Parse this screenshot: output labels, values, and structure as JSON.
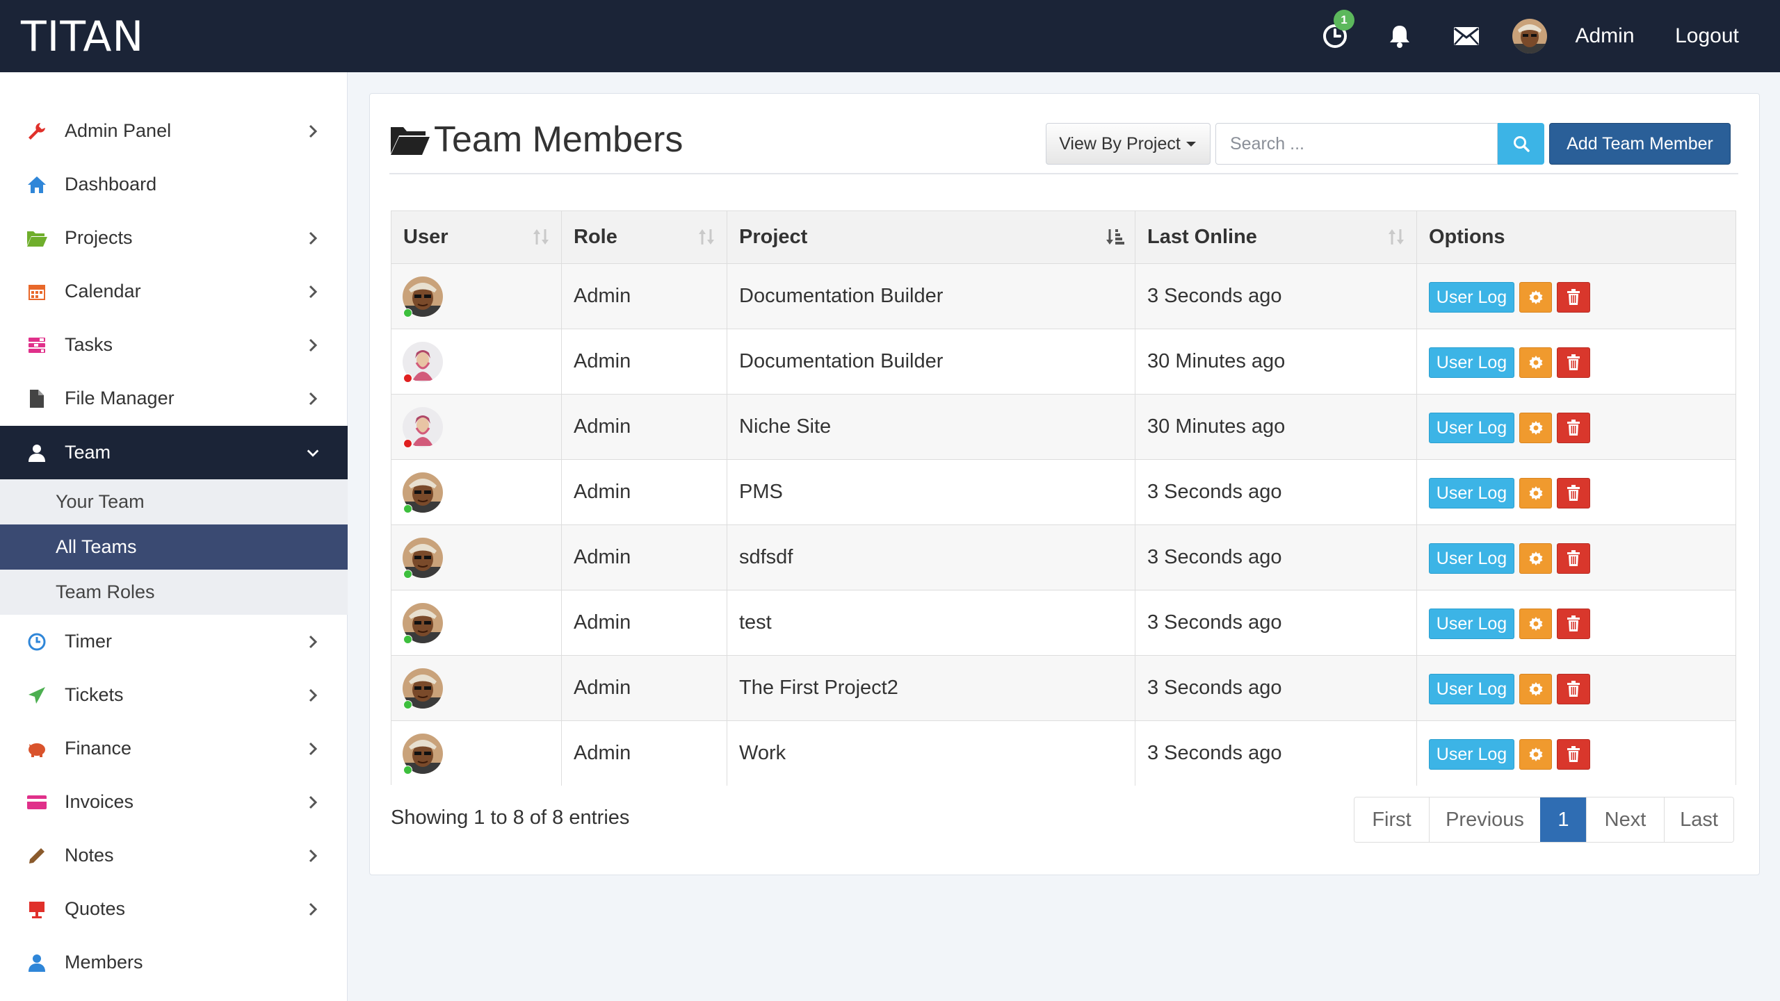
{
  "app": {
    "brand": "TITAN"
  },
  "topbar": {
    "timer_badge": "1",
    "user_name": "Admin",
    "logout": "Logout"
  },
  "sidebar": {
    "items": [
      {
        "label": "Admin Panel",
        "icon": "wrench-icon",
        "color": "#e0302a",
        "chevron": true
      },
      {
        "label": "Dashboard",
        "icon": "home-icon",
        "color": "#2f86d8",
        "chevron": false
      },
      {
        "label": "Projects",
        "icon": "folder-open-icon",
        "color": "#6fae2c",
        "chevron": true
      },
      {
        "label": "Calendar",
        "icon": "calendar-icon",
        "color": "#e8682a",
        "chevron": true
      },
      {
        "label": "Tasks",
        "icon": "tasks-icon",
        "color": "#e0308a",
        "chevron": true
      },
      {
        "label": "File Manager",
        "icon": "file-icon",
        "color": "#444444",
        "chevron": true
      },
      {
        "label": "Team",
        "icon": "user-icon",
        "color": "#ffffff",
        "chevron": true,
        "active": true
      },
      {
        "label": "Timer",
        "icon": "clock-icon",
        "color": "#2f86d8",
        "chevron": true
      },
      {
        "label": "Tickets",
        "icon": "paper-plane-icon",
        "color": "#4caf50",
        "chevron": true
      },
      {
        "label": "Finance",
        "icon": "piggy-bank-icon",
        "color": "#d9532c",
        "chevron": true
      },
      {
        "label": "Invoices",
        "icon": "credit-card-icon",
        "color": "#e0308a",
        "chevron": true
      },
      {
        "label": "Notes",
        "icon": "pencil-icon",
        "color": "#8a5a2c",
        "chevron": true
      },
      {
        "label": "Quotes",
        "icon": "presentation-icon",
        "color": "#e0302a",
        "chevron": true
      },
      {
        "label": "Members",
        "icon": "user-icon",
        "color": "#2f86d8",
        "chevron": false
      }
    ],
    "team_sub": [
      {
        "label": "Your Team"
      },
      {
        "label": "All Teams",
        "active": true
      },
      {
        "label": "Team Roles"
      }
    ]
  },
  "main": {
    "title": "Team Members",
    "view_by": "View By Project",
    "search_placeholder": "Search ...",
    "add_button": "Add Team Member",
    "columns": [
      "User",
      "Role",
      "Project",
      "Last Online",
      "Options"
    ],
    "rows": [
      {
        "avatar": "man",
        "status": "online",
        "role": "Admin",
        "project": "Documentation Builder",
        "last_online": "3 Seconds ago"
      },
      {
        "avatar": "woman",
        "status": "offline",
        "role": "Admin",
        "project": "Documentation Builder",
        "last_online": "30 Minutes ago"
      },
      {
        "avatar": "woman",
        "status": "offline",
        "role": "Admin",
        "project": "Niche Site",
        "last_online": "30 Minutes ago"
      },
      {
        "avatar": "man",
        "status": "online",
        "role": "Admin",
        "project": "PMS",
        "last_online": "3 Seconds ago"
      },
      {
        "avatar": "man",
        "status": "online",
        "role": "Admin",
        "project": "sdfsdf",
        "last_online": "3 Seconds ago"
      },
      {
        "avatar": "man",
        "status": "online",
        "role": "Admin",
        "project": "test",
        "last_online": "3 Seconds ago"
      },
      {
        "avatar": "man",
        "status": "online",
        "role": "Admin",
        "project": "The First Project2",
        "last_online": "3 Seconds ago"
      },
      {
        "avatar": "man",
        "status": "online",
        "role": "Admin",
        "project": "Work",
        "last_online": "3 Seconds ago"
      }
    ],
    "user_log_label": "User Log",
    "showing": "Showing 1 to 8 of 8 entries",
    "pagination": [
      "First",
      "Previous",
      "1",
      "Next",
      "Last"
    ],
    "current_page": "1"
  },
  "colors": {
    "topbar": "#1b2437",
    "online": "#3dbf3d",
    "offline": "#e02020",
    "info": "#3cb4e6",
    "warning": "#f09a2e",
    "danger": "#d9372c",
    "primary": "#2a5f98"
  }
}
